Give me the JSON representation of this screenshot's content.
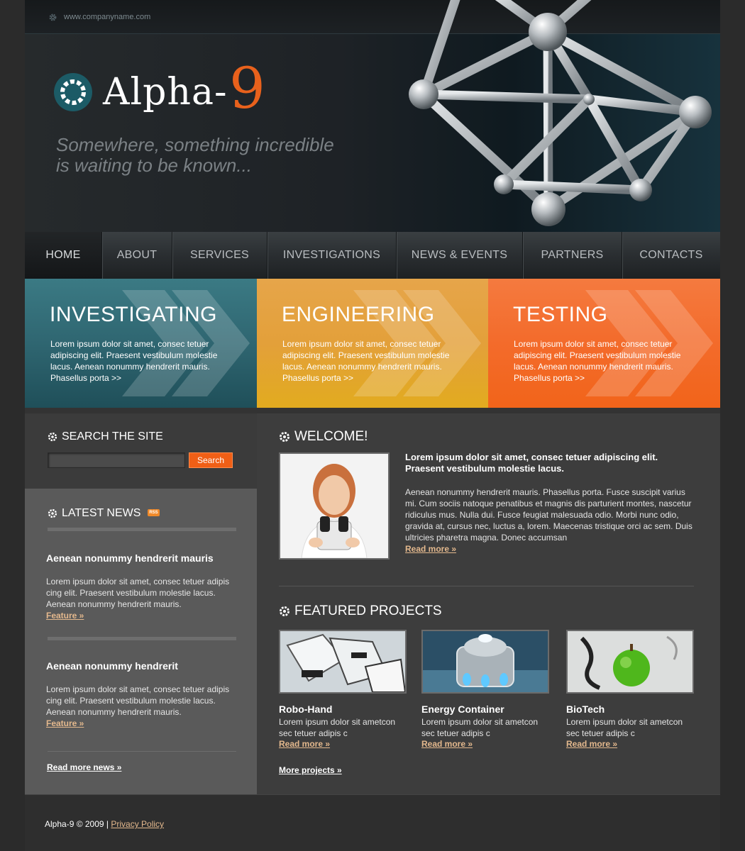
{
  "header": {
    "url": "www.companyname.com",
    "logo_text": "Alpha-",
    "logo_number": "9",
    "tagline_line1": "Somewhere, something incredible",
    "tagline_line2": "is waiting to be known..."
  },
  "nav": {
    "items": [
      "HOME",
      "ABOUT",
      "SERVICES",
      "INVESTIGATIONS",
      "NEWS & EVENTS",
      "PARTNERS",
      "CONTACTS"
    ]
  },
  "features": [
    {
      "title": "INVESTIGATING",
      "text": "Lorem ipsum dolor sit amet, consec tetuer adipiscing elit. Praesent vestibulum molestie lacus. Aenean nonummy hendrerit mauris. Phasellus porta >>"
    },
    {
      "title": "ENGINEERING",
      "text": "Lorem ipsum dolor sit amet, consec tetuer adipiscing elit. Praesent vestibulum molestie lacus. Aenean nonummy hendrerit mauris. Phasellus porta >>"
    },
    {
      "title": "TESTING",
      "text": "Lorem ipsum dolor sit amet, consec tetuer adipiscing elit. Praesent vestibulum molestie lacus. Aenean nonummy hendrerit mauris. Phasellus porta >>"
    }
  ],
  "search": {
    "title": "SEARCH THE SITE",
    "button": "Search",
    "value": ""
  },
  "news": {
    "title": "LATEST NEWS",
    "rss": "RSS",
    "items": [
      {
        "title": "Aenean nonummy hendrerit mauris",
        "text": "Lorem ipsum dolor sit amet, consec tetuer adipis cing elit. Praesent vestibulum molestie lacus. Aenean nonummy hendrerit mauris.",
        "link": "Feature »"
      },
      {
        "title": "Aenean nonummy hendrerit",
        "text": "Lorem ipsum dolor sit amet, consec tetuer adipis cing elit. Praesent vestibulum molestie lacus. Aenean nonummy hendrerit mauris.",
        "link": "Feature »"
      }
    ],
    "more": "Read more news »"
  },
  "welcome": {
    "title": "WELCOME!",
    "lead": "Lorem ipsum dolor sit amet, consec tetuer adipiscing elit. Praesent vestibulum molestie lacus.",
    "body": "Aenean nonummy hendrerit mauris. Phasellus porta. Fusce suscipit varius mi. Cum sociis natoque penatibus et magnis dis parturient montes, nascetur ridiculus mus. Nulla dui. Fusce feugiat malesuada odio. Morbi nunc odio, gravida at, cursus nec, luctus a, lorem. Maecenas tristique orci ac sem. Duis ultricies pharetra magna. Donec accumsan",
    "link": "Read more »"
  },
  "projects": {
    "title": "FEATURED PROJECTS",
    "items": [
      {
        "name": "Robo-Hand",
        "text": "Lorem ipsum dolor sit ametcon sec tetuer adipis c",
        "link": "Read more »"
      },
      {
        "name": "Energy Container",
        "text": "Lorem ipsum dolor sit ametcon sec tetuer adipis c",
        "link": "Read more »"
      },
      {
        "name": "BioTech",
        "text": "Lorem ipsum dolor sit ametcon sec tetuer adipis c",
        "link": "Read more »"
      }
    ],
    "more": "More projects »"
  },
  "footer": {
    "copyright": "Alpha-9 © 2009 | ",
    "privacy": "Privacy Policy"
  },
  "colors": {
    "accent_orange": "#f05f16",
    "teal": "#2f6671",
    "link": "#e3b88d"
  }
}
